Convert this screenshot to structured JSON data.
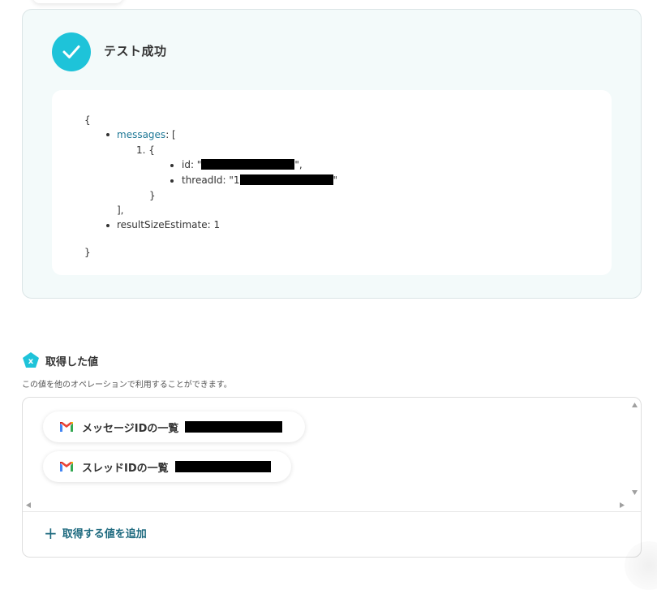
{
  "test_result": {
    "title": "テスト成功",
    "json_output": {
      "open_brace": "{",
      "messages_key": "messages",
      "messages_open": ": [",
      "item_marker": "1. {",
      "id_label": "id: \"",
      "id_suffix": "\",",
      "thread_label": "threadId: \"1",
      "thread_suffix": "\"",
      "inner_close": "}",
      "array_close": "],",
      "result_size": "resultSizeEstimate: 1",
      "close_brace": "}"
    }
  },
  "acquired_values": {
    "title": "取得した値",
    "description": "この値を他のオペレーションで利用することができます。",
    "items": [
      {
        "label": "メッセージIDの一覧",
        "icon": "gmail-icon"
      },
      {
        "label": "スレッドIDの一覧",
        "icon": "gmail-icon"
      }
    ],
    "add_button": "取得する値を追加"
  },
  "colors": {
    "accent_teal": "#1ec3d9",
    "panel_bg": "#f3fafa",
    "link_teal": "#1e6a7f",
    "key_blue": "#1e7896"
  }
}
